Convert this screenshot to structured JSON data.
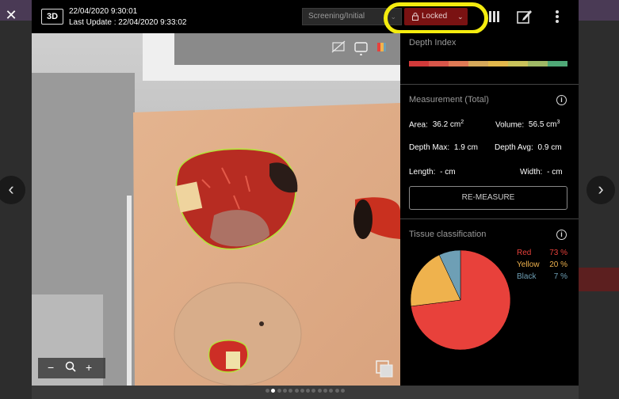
{
  "header": {
    "close_icon": "close-icon",
    "badge": "3D",
    "created": "22/04/2020 9:30:01",
    "last_update": "Last Update : 22/04/2020 9:33:02",
    "stage": "Screening/Initial",
    "lock_label": "Locked",
    "icons": [
      "pause-icon",
      "edit-icon",
      "more-icon"
    ]
  },
  "depth_index": {
    "title": "Depth Index",
    "colors": [
      "#d23a3a",
      "#d8564a",
      "#e07a55",
      "#d6a85a",
      "#e3b84c",
      "#c9c25a",
      "#9fb865",
      "#4fa877"
    ]
  },
  "measurement": {
    "title": "Measurement (Total)",
    "area_label": "Area:",
    "area_value": "36.2 cm",
    "area_unit_exp": "2",
    "volume_label": "Volume:",
    "volume_value": "56.5 cm",
    "volume_unit_exp": "3",
    "depth_max_label": "Depth Max:",
    "depth_max_value": "1.9 cm",
    "depth_avg_label": "Depth Avg:",
    "depth_avg_value": "0.9 cm",
    "length_label": "Length:",
    "length_value": "- cm",
    "width_label": "Width:",
    "width_value": "- cm",
    "remeasure_label": "RE-MEASURE"
  },
  "tissue": {
    "title": "Tissue classification",
    "classes": [
      {
        "name": "Red",
        "percent": "73 %",
        "value": 73,
        "color": "#e8413b"
      },
      {
        "name": "Yellow",
        "percent": "20 %",
        "value": 20,
        "color": "#efb24d"
      },
      {
        "name": "Black",
        "percent": "7 %",
        "value": 7,
        "color": "#6e9fb5"
      }
    ]
  },
  "zoom": {
    "minus": "−",
    "plus": "+"
  },
  "pager": {
    "count": 14,
    "active": 1
  },
  "highlight_color": "#f4ec0f"
}
